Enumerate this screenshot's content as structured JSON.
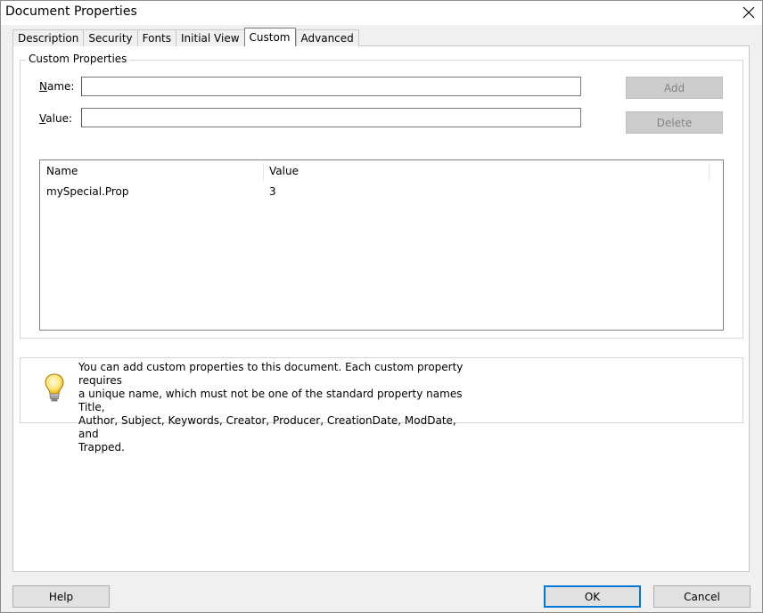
{
  "window": {
    "title": "Document Properties",
    "close_glyph": "✕"
  },
  "tabs": [
    {
      "label": "Description"
    },
    {
      "label": "Security"
    },
    {
      "label": "Fonts"
    },
    {
      "label": "Initial View"
    },
    {
      "label": "Custom"
    },
    {
      "label": "Advanced"
    }
  ],
  "custom": {
    "group_label": "Custom Properties",
    "name_label": "Name:",
    "name_value": "",
    "value_label": "Value:",
    "value_value": "",
    "add_label": "Add",
    "delete_label": "Delete",
    "table": {
      "columns": [
        "Name",
        "Value"
      ],
      "rows": [
        {
          "name": "mySpecial.Prop",
          "value": "3"
        }
      ]
    }
  },
  "info": {
    "icon": "lightbulb-icon",
    "lines": [
      "You can add custom properties to this document. Each custom property requires",
      "a unique name, which must not be one of the standard property names Title,",
      "Author, Subject, Keywords, Creator, Producer, CreationDate, ModDate, and",
      "Trapped."
    ]
  },
  "footer": {
    "help_label": "Help",
    "ok_label": "OK",
    "cancel_label": "Cancel"
  },
  "colors": {
    "accent": "#0078d7",
    "disabled_button": "#cccccc"
  }
}
